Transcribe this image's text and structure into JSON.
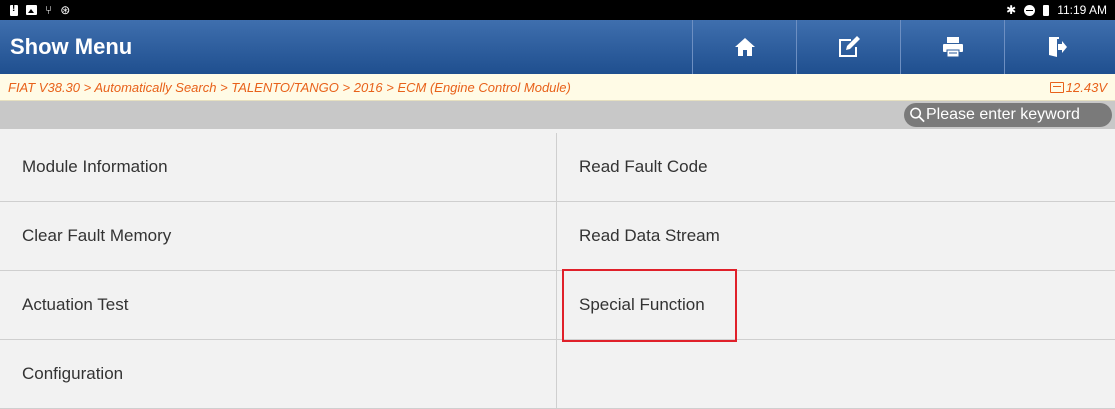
{
  "status_bar": {
    "time": "11:19 AM"
  },
  "header": {
    "title": "Show Menu",
    "buttons": [
      {
        "name": "home-button",
        "icon": "home-icon"
      },
      {
        "name": "edit-button",
        "icon": "edit-icon"
      },
      {
        "name": "print-button",
        "icon": "print-icon"
      },
      {
        "name": "exit-button",
        "icon": "exit-icon"
      }
    ]
  },
  "breadcrumb": {
    "path": "FIAT V38.30 > Automatically Search > TALENTO/TANGO > 2016 > ECM (Engine Control Module)",
    "voltage": "12.43V"
  },
  "search": {
    "placeholder": "Please enter keyword"
  },
  "menu": {
    "items": [
      "Module Information",
      "Read Fault Code",
      "Clear Fault Memory",
      "Read Data Stream",
      "Actuation Test",
      "Special Function",
      "Configuration",
      ""
    ]
  },
  "colors": {
    "header": "#2a5a9a",
    "breadcrumb_text": "#e8611a",
    "highlight": "#e0202a"
  }
}
